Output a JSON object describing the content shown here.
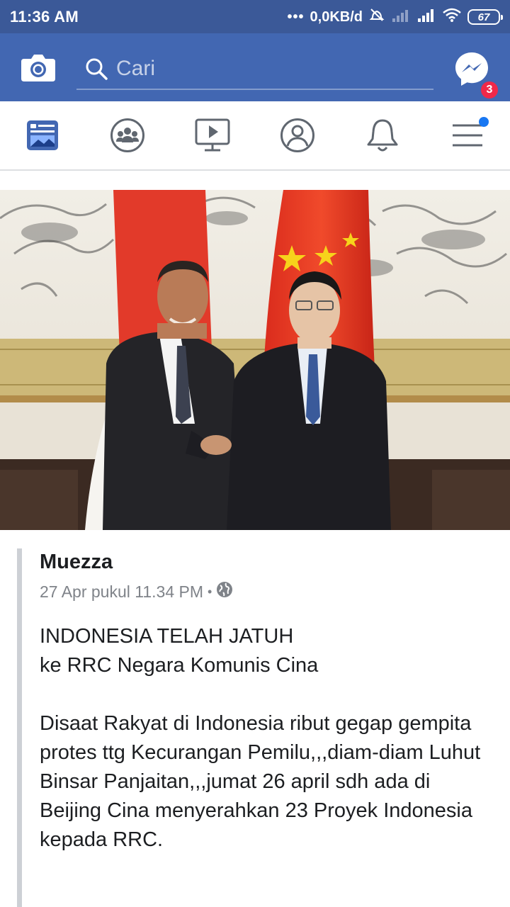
{
  "status_bar": {
    "time": "11:36 AM",
    "dots": "•••",
    "net_speed": "0,0KB/d",
    "battery": "67"
  },
  "app_bar": {
    "search_placeholder": "Cari",
    "messenger_badge": "3",
    "icons": [
      "camera-icon",
      "search-icon",
      "messenger-icon"
    ]
  },
  "tabs": [
    {
      "name": "news-feed",
      "icon": "news-feed-icon",
      "active": true
    },
    {
      "name": "groups",
      "icon": "groups-icon",
      "active": false
    },
    {
      "name": "watch",
      "icon": "video-icon",
      "active": false
    },
    {
      "name": "profile",
      "icon": "profile-icon",
      "active": false
    },
    {
      "name": "notifications",
      "icon": "bell-icon",
      "active": false
    },
    {
      "name": "menu",
      "icon": "menu-icon",
      "active": false,
      "has_dot": true
    }
  ],
  "post": {
    "author": "Muezza",
    "timestamp": "27 Apr pukul 11.34 PM",
    "separator": "•",
    "paragraphs": [
      "INDONESIA TELAH JATUH\nke RRC Negara Komunis Cina",
      "Disaat Rakyat di Indonesia ribut gegap gempita protes ttg Kecurangan Pemilu,,,diam-diam Luhut Binsar Panjaitan,,,jumat 26 april sdh ada di Beijing Cina menyerahkan 23 Proyek Indonesia kepada RRC."
    ]
  },
  "colors": {
    "facebook_blue": "#4267b2",
    "status_bar": "#3b5998",
    "badge_red": "#f02849",
    "active_tab": "#4267b2",
    "icon_gray": "#606770",
    "dot_blue": "#1877f2"
  }
}
